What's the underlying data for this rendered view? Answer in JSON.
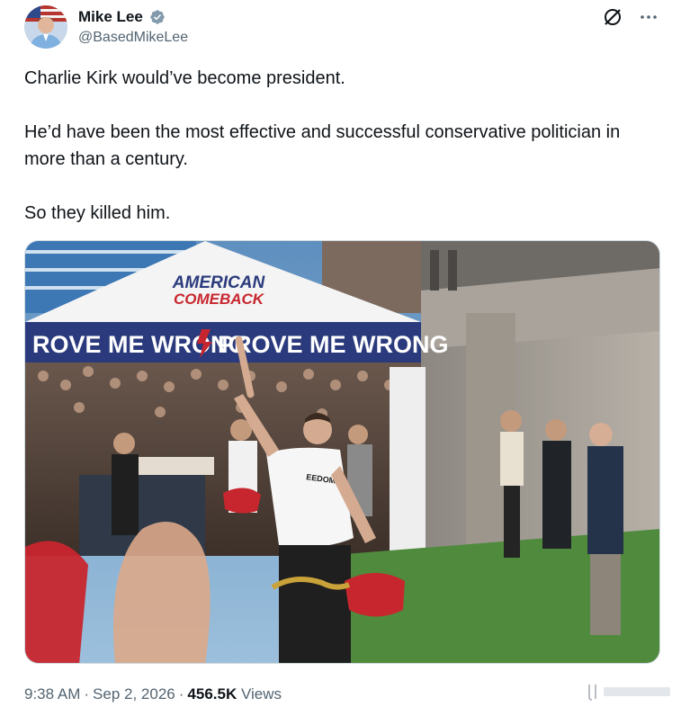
{
  "post": {
    "author": {
      "display_name": "Mike Lee",
      "handle": "@BasedMikeLee",
      "verified": true
    },
    "text": {
      "p1": "Charlie Kirk would’ve become president.",
      "p2": "He’d have been the most effective and successful conservative politician in more than a century.",
      "p3": "So they killed him."
    },
    "media": {
      "tent_brand_line1": "AMERICAN",
      "tent_brand_line2": "COMEBACK",
      "banner_left": "ROVE ME WRONG",
      "banner_right": "PROVE ME WRONG",
      "shirt_text": "EEDOM"
    },
    "meta": {
      "time": "9:38 AM",
      "separator": "·",
      "date": "Sep 2, 2026",
      "views_count": "456.5K",
      "views_label": "Views"
    }
  },
  "icons": {
    "verified": "verified-badge-icon",
    "grok": "grok-icon",
    "more": "more-options-icon"
  },
  "colors": {
    "verified_badge": "#829aab",
    "text_secondary": "#536471",
    "text_primary": "#0f1419",
    "banner_navy": "#2a3a7c",
    "brand_red": "#c8262e"
  }
}
